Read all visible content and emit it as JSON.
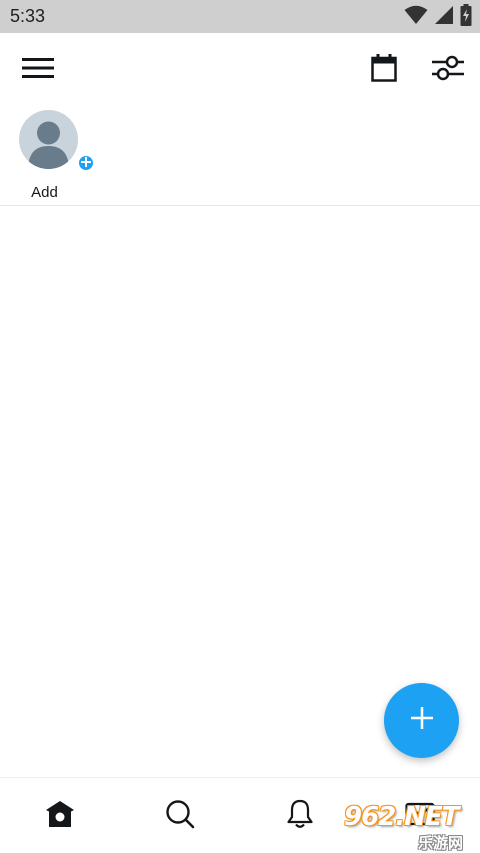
{
  "status_bar": {
    "time": "5:33",
    "icons": [
      "wifi-icon",
      "signal-icon",
      "battery-charging-icon"
    ]
  },
  "app_bar": {
    "icons": [
      "menu-icon",
      "calendar-icon",
      "sliders-icon"
    ]
  },
  "story_row": {
    "items": [
      {
        "label": "Add",
        "icon": "default-avatar-icon",
        "badge_icon": "plus-icon"
      }
    ]
  },
  "fab": {
    "icon": "plus-icon"
  },
  "bottom_nav": {
    "tabs": [
      {
        "name": "home",
        "icon": "home-icon",
        "active": true
      },
      {
        "name": "search",
        "icon": "search-icon",
        "active": false
      },
      {
        "name": "notifications",
        "icon": "bell-icon",
        "active": false
      },
      {
        "name": "messages",
        "icon": "mail-icon",
        "active": false
      }
    ]
  },
  "watermark": {
    "main": "962.NET",
    "sub": "乐游网"
  },
  "colors": {
    "accent": "#1da1f2",
    "status_bar_bg": "#cfcfcf",
    "text": "#14171a",
    "avatar_bg": "#c9d3db",
    "avatar_fg": "#687c8c",
    "divider": "#e2e6e9"
  }
}
